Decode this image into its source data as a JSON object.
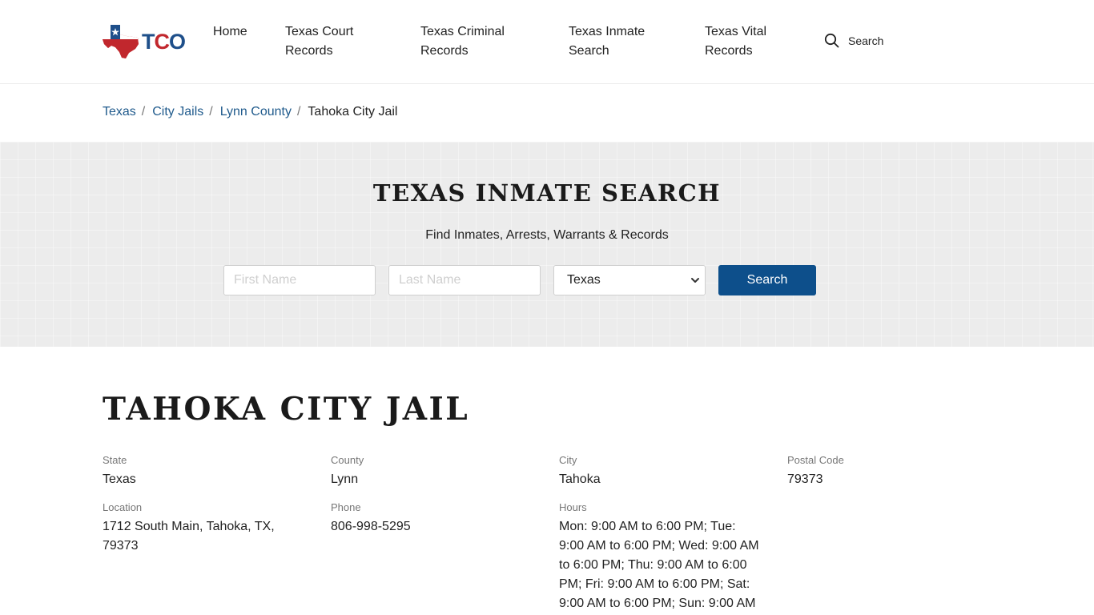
{
  "header": {
    "logo": {
      "text_parts": [
        "T",
        "C",
        "O"
      ],
      "colors": [
        "#1e4f8a",
        "#c1272d",
        "#1e4f8a"
      ],
      "icon": "texas-flag-map-icon"
    },
    "nav": [
      {
        "label": "Home"
      },
      {
        "label": "Texas Court Records"
      },
      {
        "label": "Texas Criminal Records"
      },
      {
        "label": "Texas Inmate Search"
      },
      {
        "label": "Texas Vital Records"
      }
    ],
    "search": {
      "label": "Search",
      "icon": "search-icon"
    }
  },
  "breadcrumb": {
    "items": [
      "Texas",
      "City Jails",
      "Lynn County"
    ],
    "separator": "/",
    "current": "Tahoka City Jail"
  },
  "search_banner": {
    "title": "TEXAS INMATE SEARCH",
    "subtitle": "Find Inmates, Arrests, Warrants & Records",
    "first_name_placeholder": "First Name",
    "last_name_placeholder": "Last Name",
    "state_selected": "Texas",
    "button_label": "Search",
    "button_color": "#0d4f8b"
  },
  "page": {
    "title": "TAHOKA CITY JAIL",
    "fields": [
      {
        "label": "State",
        "value": "Texas"
      },
      {
        "label": "County",
        "value": "Lynn"
      },
      {
        "label": "City",
        "value": "Tahoka"
      },
      {
        "label": "Postal Code",
        "value": "79373"
      },
      {
        "label": "Location",
        "value": "1712 South Main, Tahoka, TX, 79373"
      },
      {
        "label": "Phone",
        "value": "806-998-5295"
      },
      {
        "label": "Hours",
        "value": "Mon: 9:00 AM to 6:00 PM; Tue: 9:00 AM to 6:00 PM; Wed: 9:00 AM to 6:00 PM; Thu: 9:00 AM to 6:00 PM; Fri: 9:00 AM to 6:00 PM; Sat: 9:00 AM to 6:00 PM; Sun: 9:00 AM"
      }
    ]
  },
  "colors": {
    "link": "#1f5a8c",
    "accent": "#0d4f8b",
    "flag_red": "#c1272d",
    "flag_blue": "#1e4f8a"
  }
}
